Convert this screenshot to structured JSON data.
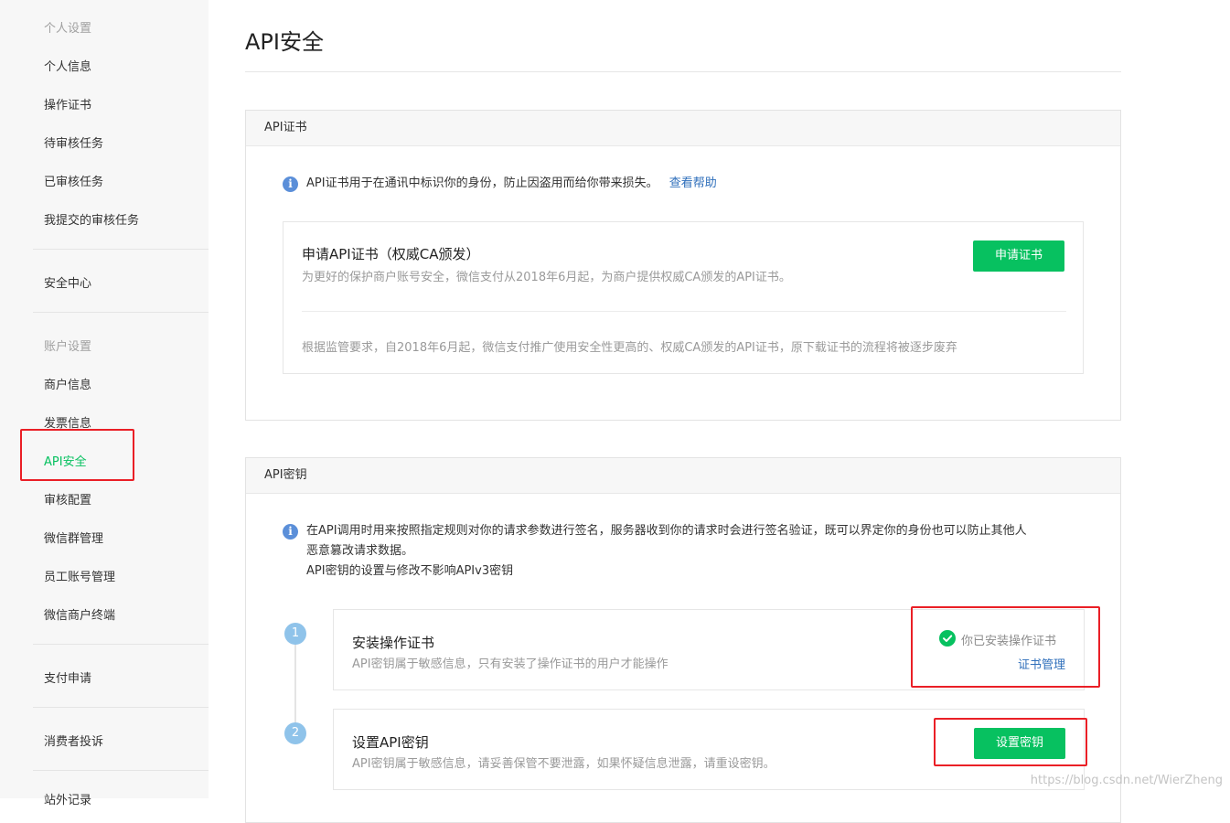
{
  "sidebar": {
    "group_personal": "个人设置",
    "personal_items": [
      "个人信息",
      "操作证书",
      "待审核任务",
      "已审核任务",
      "我提交的审核任务"
    ],
    "security_center": "安全中心",
    "group_account": "账户设置",
    "account_items": [
      "商户信息",
      "发票信息",
      "API安全",
      "审核配置",
      "微信群管理",
      "员工账号管理",
      "微信商户终端"
    ],
    "payment_apply": "支付申请",
    "consumer_complaint": "消费者投诉",
    "partial_bottom": "站外记录"
  },
  "page": {
    "title": "API安全"
  },
  "cert_panel": {
    "header": "API证书",
    "info_text": "API证书用于在通讯中标识你的身份，防止因盗用而给你带来损失。",
    "help_link": "查看帮助",
    "card_title": "申请API证书（权威CA颁发）",
    "card_desc": "为更好的保护商户账号安全，微信支付从2018年6月起，为商户提供权威CA颁发的API证书。",
    "apply_button": "申请证书",
    "notice": "根据监管要求，自2018年6月起，微信支付推广使用安全性更高的、权威CA颁发的API证书，原下载证书的流程将被逐步废弃"
  },
  "key_panel": {
    "header": "API密钥",
    "info_line1": "在API调用时用来按照指定规则对你的请求参数进行签名，服务器收到你的请求时会进行签名验证，既可以界定你的身份也可以防止其他人",
    "info_line2": "恶意篡改请求数据。",
    "info_line3": "API密钥的设置与修改不影响APIv3密钥",
    "steps": [
      {
        "number": "1",
        "title": "安装操作证书",
        "desc": "API密钥属于敏感信息，只有安装了操作证书的用户才能操作",
        "status": "你已安装操作证书",
        "link": "证书管理"
      },
      {
        "number": "2",
        "title": "设置API密钥",
        "desc": "API密钥属于敏感信息，请妥善保管不要泄露，如果怀疑信息泄露，请重设密钥。",
        "button": "设置密钥"
      }
    ]
  },
  "watermark": "https://blog.csdn.net/WierZheng",
  "colors": {
    "accent": "#07c160",
    "link": "#2f6fbb",
    "highlight": "#ea1f26"
  }
}
